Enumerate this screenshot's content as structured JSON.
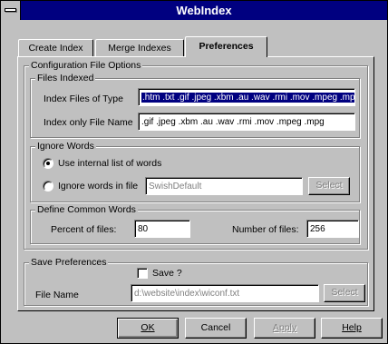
{
  "window": {
    "title": "WebIndex"
  },
  "tabs": [
    {
      "label": "Create Index"
    },
    {
      "label": "Merge Indexes"
    },
    {
      "label": "Preferences"
    }
  ],
  "config": {
    "group_label": "Configuration File Options",
    "files_indexed": {
      "label": "Files Indexed",
      "index_files_label": "Index Files of Type",
      "index_files_value": ".htm .txt .gif .jpeg .xbm .au .wav .rmi .mov .mpeg .mpg",
      "index_only_label": "Index only File Name",
      "index_only_value": ".gif .jpeg .xbm .au .wav .rmi .mov .mpeg .mpg"
    },
    "ignore_words": {
      "label": "Ignore Words",
      "use_internal_label": "Use internal list of words",
      "ignore_in_file_label": "Ignore words in file",
      "ignore_file_value": "SwishDefault",
      "select_label": "Select",
      "selected_option": "use_internal"
    },
    "common_words": {
      "label": "Define Common Words",
      "percent_label": "Percent of files:",
      "percent_value": "80",
      "number_label": "Number of files:",
      "number_value": "256"
    }
  },
  "save_prefs": {
    "label": "Save Preferences",
    "save_checkbox_label": "Save ?",
    "save_checked": false,
    "file_name_label": "File Name",
    "file_name_value": "d:\\website\\index\\wiconf.txt",
    "select_label": "Select"
  },
  "buttons": {
    "ok": "OK",
    "cancel": "Cancel",
    "apply": "Apply",
    "help": "Help"
  }
}
